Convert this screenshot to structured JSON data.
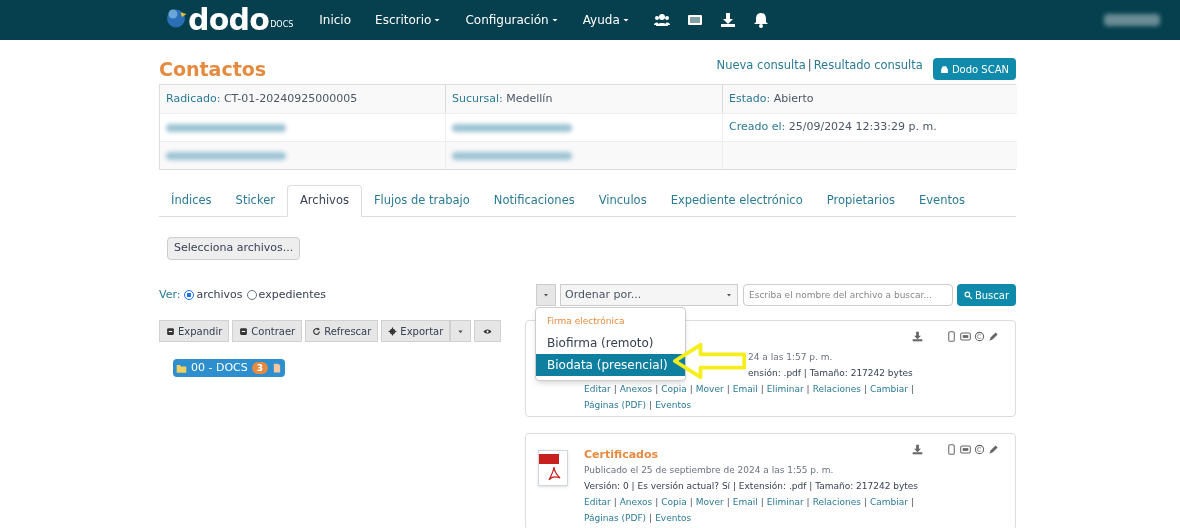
{
  "navbar": {
    "logo": "dodo",
    "logo_sub": "DOCS",
    "menu": [
      {
        "label": "Inicio",
        "dropdown": false
      },
      {
        "label": "Escritorio",
        "dropdown": true
      },
      {
        "label": "Configuración",
        "dropdown": true
      },
      {
        "label": "Ayuda",
        "dropdown": true
      }
    ]
  },
  "page": {
    "title": "Contactos",
    "links": [
      "Nueva consulta",
      "Resultado consulta"
    ],
    "separator": "|",
    "scan_button": "Dodo SCAN"
  },
  "info": [
    [
      {
        "label": "Radicado:",
        "value": "CT-01-20240925000005"
      },
      {
        "label": "Sucursal:",
        "value": "Medellín"
      },
      {
        "label": "Estado:",
        "value": "Abierto"
      }
    ],
    [
      {
        "blurred": true
      },
      {
        "blurred": true
      },
      {
        "label": "Creado el:",
        "value": "25/09/2024 12:33:29 p. m."
      }
    ],
    [
      {
        "blurred": true
      },
      {
        "blurred": true
      }
    ]
  ],
  "tabs": [
    {
      "label": "Índices",
      "selected": false
    },
    {
      "label": "Sticker",
      "selected": false
    },
    {
      "label": "Archivos",
      "selected": true
    },
    {
      "label": "Flujos de trabajo",
      "selected": false
    },
    {
      "label": "Notificaciones",
      "selected": false
    },
    {
      "label": "Vinculos",
      "selected": false
    },
    {
      "label": "Expediente electrónico",
      "selected": false
    },
    {
      "label": "Propietarios",
      "selected": false
    },
    {
      "label": "Eventos",
      "selected": false
    }
  ],
  "select_files": "Selecciona archivos...",
  "view": {
    "label": "Ver:",
    "options": [
      {
        "label": "archivos",
        "selected": true
      },
      {
        "label": "expedientes",
        "selected": false
      }
    ]
  },
  "toolbar": [
    {
      "kind": "square",
      "label": "Expandir"
    },
    {
      "kind": "square",
      "label": "Contraer"
    },
    {
      "kind": "refresh",
      "label": "Refrescar"
    },
    {
      "kind": "gear",
      "label": "Exportar"
    },
    {
      "kind": "caret"
    },
    {
      "kind": "eye"
    }
  ],
  "folder": {
    "label": "00 - DOCS",
    "count": "3"
  },
  "sort": {
    "placeholder": "Ordenar por...",
    "search_placeholder": "Escriba el nombre del archivo a buscar...",
    "search_button": "Buscar"
  },
  "dropdown": {
    "header": "Firma electrónica",
    "items": [
      {
        "label": "Biofirma (remoto)",
        "selected": false
      },
      {
        "label": "Biodata (presencial)",
        "selected": true
      }
    ]
  },
  "files": [
    {
      "published": "24 a las 1:57 p. m.",
      "meta": "ensión: .pdf | Tamaño: 217242 bytes",
      "separator": "|",
      "actions": [
        "Editar",
        "Anexos",
        "Copia",
        "Mover",
        "Email",
        "Eliminar",
        "Relaciones",
        "Cambiar",
        "Páginas (PDF)",
        "Eventos"
      ]
    },
    {
      "title": "Certificados",
      "published": "Publicado el 25 de septiembre de 2024 a las 1:55 p. m.",
      "meta": "Versión: 0 | Es versión actual? Sí | Extensión: .pdf | Tamaño: 217242 bytes",
      "separator": "|",
      "actions": [
        "Editar",
        "Anexos",
        "Copia",
        "Mover",
        "Email",
        "Eliminar",
        "Relaciones",
        "Cambiar",
        "Páginas (PDF)",
        "Eventos"
      ]
    }
  ]
}
